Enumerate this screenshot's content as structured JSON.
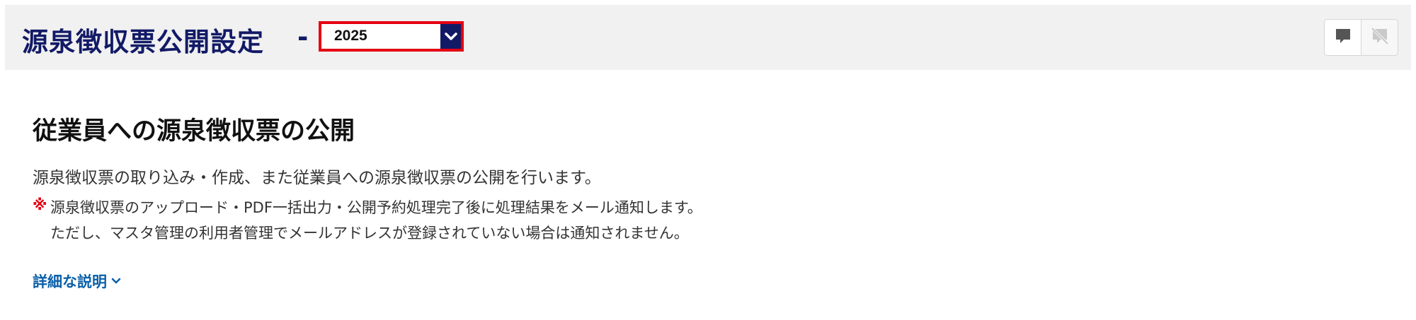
{
  "header": {
    "title": "源泉徴収票公開設定",
    "separator": "-",
    "year_select": {
      "selected": "2025"
    },
    "toggle": {
      "on_icon": "comment-icon",
      "off_icon": "comment-off-icon"
    }
  },
  "main": {
    "heading": "従業員への源泉徴収票の公開",
    "description": "源泉徴収票の取り込み・作成、また従業員への源泉徴収票の公開を行います。",
    "note_mark": "※",
    "note_line1": "源泉徴収票のアップロード・PDF一括出力・公開予約処理完了後に処理結果をメール通知します。",
    "note_line2": "ただし、マスタ管理の利用者管理でメールアドレスが登録されていない場合は通知されません。",
    "detail_link": "詳細な説明"
  },
  "colors": {
    "title": "#121a66",
    "select_border": "#e50012",
    "link": "#0a5fa8",
    "note_mark": "#e50012",
    "header_bg": "#f1f1f1"
  }
}
